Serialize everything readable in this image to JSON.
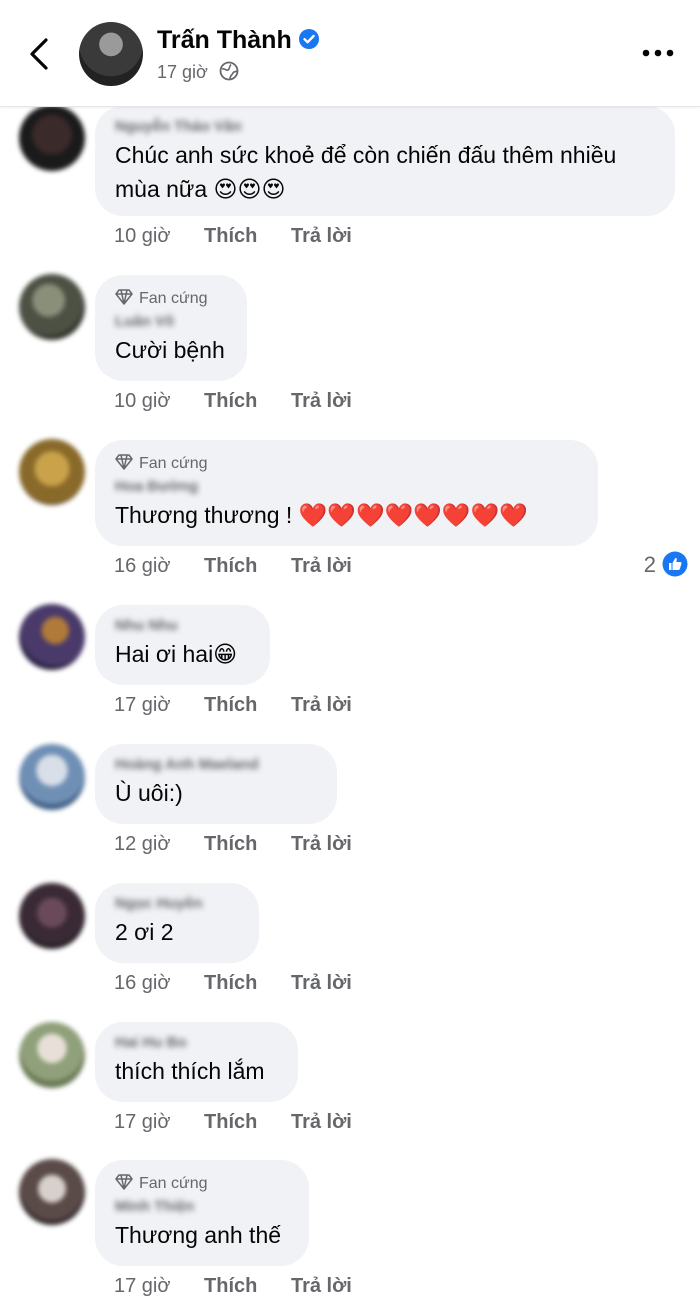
{
  "header": {
    "name": "Trấn Thành",
    "time": "17 giờ",
    "verified": true
  },
  "actions": {
    "like": "Thích",
    "reply": "Trả lời"
  },
  "badge_label": "Fan cứng",
  "comments": [
    {
      "author": "Nguyễn Thảo Vân",
      "text": "Chúc anh sức khoẻ để còn chiến đấu thêm nhiều\nmùa nữa 😍😍😍",
      "time": "10 giờ",
      "badge": false
    },
    {
      "author": "Luân Võ",
      "text": "Cười bệnh",
      "time": "10 giờ",
      "badge": true
    },
    {
      "author": "Hoa Đường",
      "text": "Thương thương ! ❤️❤️❤️❤️❤️❤️❤️❤️",
      "time": "16 giờ",
      "badge": true,
      "reactions": "2"
    },
    {
      "author": "Nhu Nhu",
      "text": "Hai ơi hai😁",
      "time": "17 giờ",
      "badge": false
    },
    {
      "author": "Hoàng Anh Maeland",
      "text": "Ù uôi:)",
      "time": "12 giờ",
      "badge": false
    },
    {
      "author": "Ngọc Huyền",
      "text": "2 ơi 2",
      "time": "16 giờ",
      "badge": false
    },
    {
      "author": "Hai Hu Bo",
      "text": "thích thích lắm",
      "time": "17 giờ",
      "badge": false
    },
    {
      "author": "Minh Thiện",
      "text": "Thương anh thế",
      "time": "17 giờ",
      "badge": true
    }
  ],
  "colors": {
    "bubble": "#f0f2f5",
    "meta": "#65676b",
    "brand": "#1877f2"
  }
}
